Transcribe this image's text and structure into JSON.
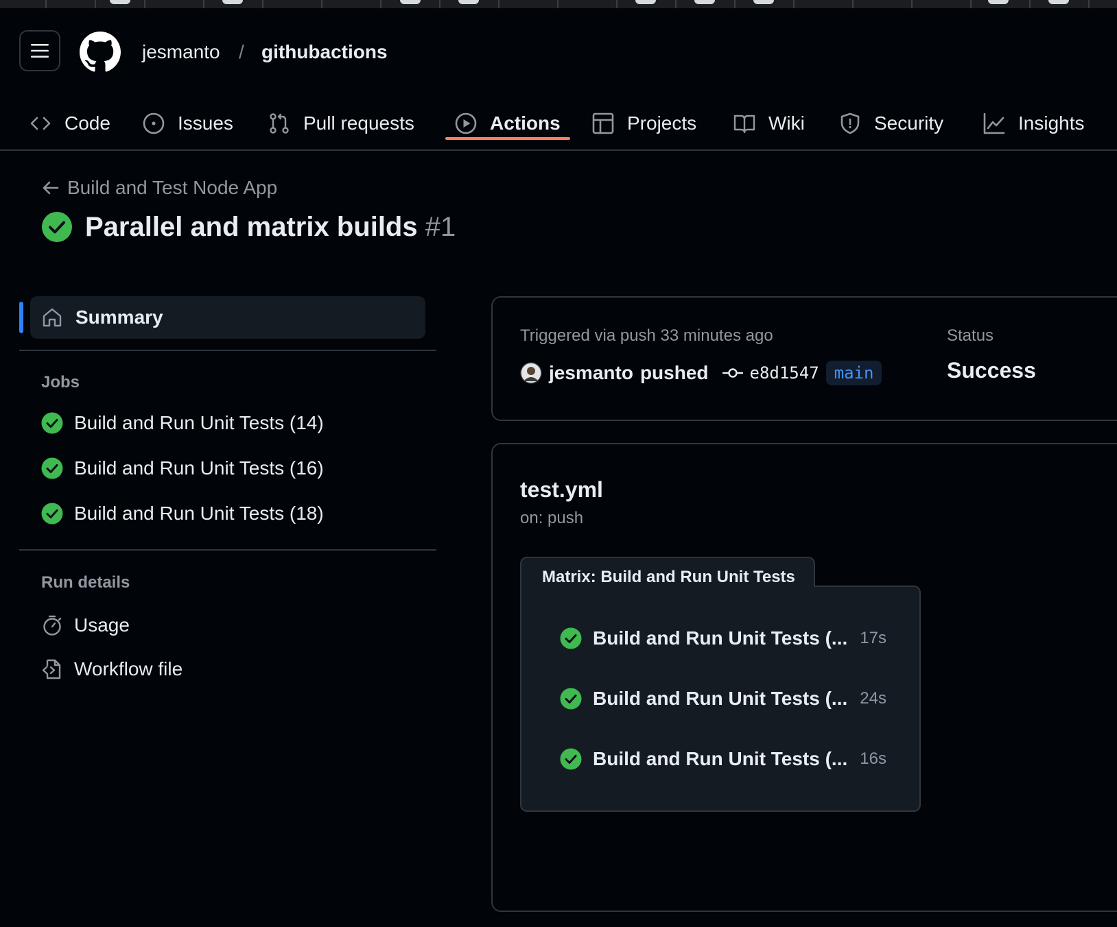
{
  "header": {
    "owner": "jesmanto",
    "separator": "/",
    "repo": "githubactions"
  },
  "nav": [
    {
      "label": "Code",
      "icon": "code-icon"
    },
    {
      "label": "Issues",
      "icon": "issue-icon"
    },
    {
      "label": "Pull requests",
      "icon": "pull-request-icon"
    },
    {
      "label": "Actions",
      "icon": "play-icon",
      "active": true
    },
    {
      "label": "Projects",
      "icon": "table-icon"
    },
    {
      "label": "Wiki",
      "icon": "book-icon"
    },
    {
      "label": "Security",
      "icon": "shield-icon"
    },
    {
      "label": "Insights",
      "icon": "graph-icon"
    }
  ],
  "run": {
    "workflow_link": "Build and Test Node App",
    "title": "Parallel and matrix builds",
    "number": "#1"
  },
  "sidebar": {
    "summary_label": "Summary",
    "jobs_heading": "Jobs",
    "jobs": [
      {
        "label": "Build and Run Unit Tests (14)"
      },
      {
        "label": "Build and Run Unit Tests (16)"
      },
      {
        "label": "Build and Run Unit Tests (18)"
      }
    ],
    "run_details_heading": "Run details",
    "usage_label": "Usage",
    "workflow_file_label": "Workflow file"
  },
  "trigger": {
    "text": "Triggered via push 33 minutes ago",
    "user": "jesmanto",
    "action": "pushed",
    "sha": "e8d1547",
    "branch": "main",
    "status_label": "Status",
    "status_value": "Success"
  },
  "workflow": {
    "file": "test.yml",
    "event": "on: push",
    "matrix_title": "Matrix: Build and Run Unit Tests",
    "jobs": [
      {
        "label": "Build and Run Unit Tests (...",
        "duration": "17s"
      },
      {
        "label": "Build and Run Unit Tests (...",
        "duration": "24s"
      },
      {
        "label": "Build and Run Unit Tests (...",
        "duration": "16s"
      }
    ]
  },
  "colors": {
    "success": "#3fb950",
    "accent_underline": "#f78166",
    "link": "#4493f8"
  }
}
